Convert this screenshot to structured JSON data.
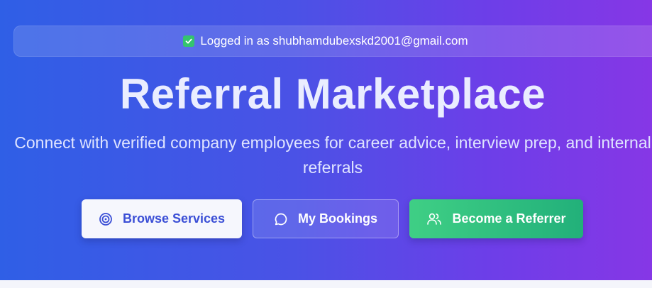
{
  "login_banner": {
    "text": "Logged in as shubhamdubexskd2001@gmail.com",
    "icon": "check-square-icon"
  },
  "hero": {
    "title": "Referral Marketplace",
    "subtitle": "Connect with verified company employees for career advice, interview prep, and internal referrals"
  },
  "actions": {
    "browse_label": "Browse Services",
    "browse_icon": "target-icon",
    "bookings_label": "My Bookings",
    "bookings_icon": "message-circle-icon",
    "referrer_label": "Become a Referrer",
    "referrer_icon": "users-icon"
  },
  "colors": {
    "gradient_start": "#2f5fe6",
    "gradient_end": "#8637e6",
    "success_green": "#34c46e",
    "accent_blue": "#3b4fd6",
    "referrer_green": "#22b07a"
  }
}
